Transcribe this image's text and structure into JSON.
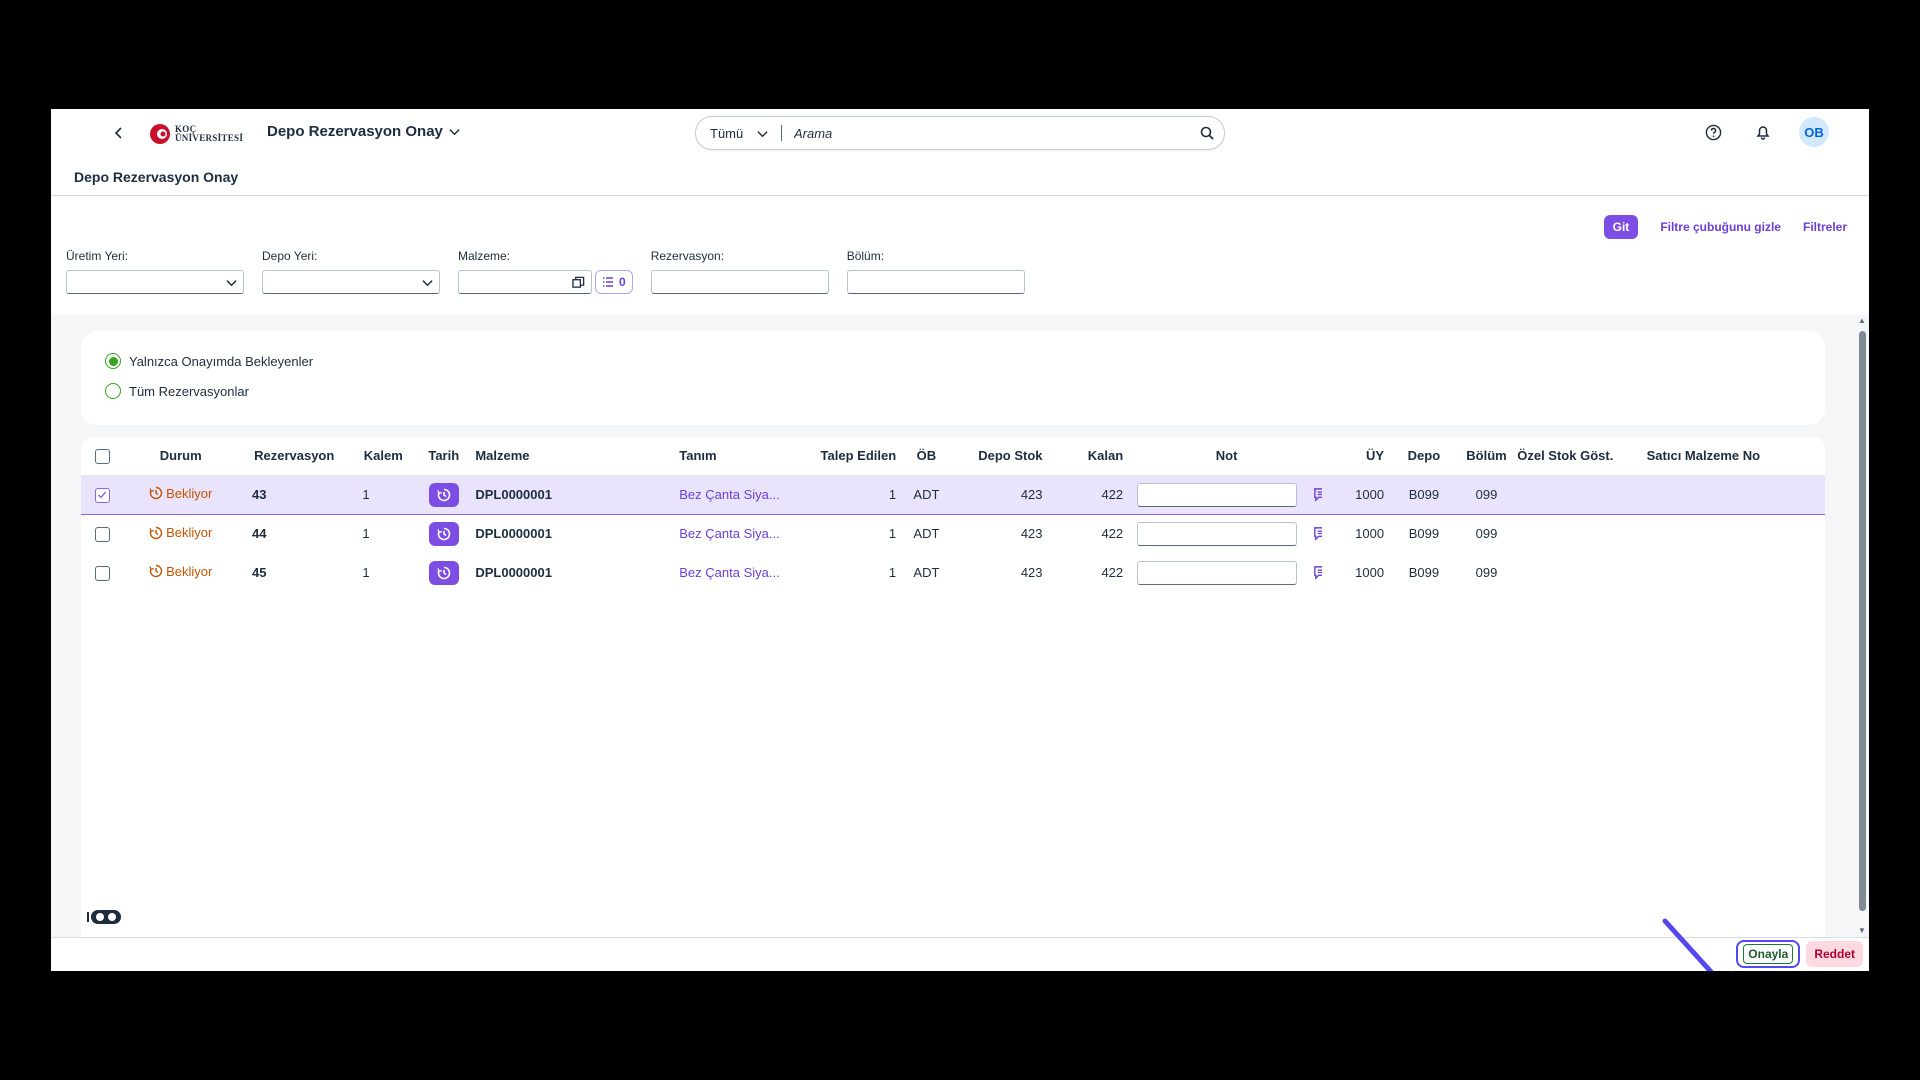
{
  "colors": {
    "accent": "#7d4ee3",
    "pending": "#c35500",
    "radio_selected": "#36a41d",
    "annotation_arrow": "#5548f0",
    "reject_bg": "#fdd9e1"
  },
  "shell": {
    "logo_line1": "KOÇ",
    "logo_line2": "ÜNİVERSİTESİ",
    "app_title": "Depo Rezervasyon Onay",
    "search_scope": "Tümü",
    "search_placeholder": "Arama",
    "avatar_initials": "OB"
  },
  "page": {
    "title": "Depo Rezervasyon Onay"
  },
  "filter_bar": {
    "go_label": "Git",
    "hide_label": "Filtre çubuğunu gizle",
    "filters_label": "Filtreler",
    "fields": {
      "plant_label": "Üretim Yeri:",
      "storage_label": "Depo Yeri:",
      "material_label": "Malzeme:",
      "material_token_count": "0",
      "reservation_label": "Rezervasyon:",
      "section_label": "Bölüm:"
    }
  },
  "radio_options": {
    "pending_only": "Yalnızca Onayımda Bekleyenler",
    "all": "Tüm Rezervasyonlar"
  },
  "table": {
    "columns": {
      "status": "Durum",
      "reservation": "Rezervasyon",
      "item": "Kalem",
      "date": "Tarih",
      "material": "Malzeme",
      "description": "Tanım",
      "requested": "Talep Edilen",
      "unit": "ÖB",
      "stock": "Depo Stok",
      "remaining": "Kalan",
      "note": "Not",
      "plant": "ÜY",
      "storage": "Depo",
      "section": "Bölüm",
      "special_stock": "Özel Stok Göst.",
      "vendor_material": "Satıcı Malzeme No"
    },
    "rows": [
      {
        "status": "Bekliyor",
        "reservation": "43",
        "item": "1",
        "material": "DPL0000001",
        "description": "Bez Çanta Siya...",
        "requested": "1",
        "unit": "ADT",
        "stock": "423",
        "remaining": "422",
        "plant": "1000",
        "storage": "B099",
        "section": "099",
        "selected": true
      },
      {
        "status": "Bekliyor",
        "reservation": "44",
        "item": "1",
        "material": "DPL0000001",
        "description": "Bez Çanta Siya...",
        "requested": "1",
        "unit": "ADT",
        "stock": "423",
        "remaining": "422",
        "plant": "1000",
        "storage": "B099",
        "section": "099",
        "selected": false
      },
      {
        "status": "Bekliyor",
        "reservation": "45",
        "item": "1",
        "material": "DPL0000001",
        "description": "Bez Çanta Siya...",
        "requested": "1",
        "unit": "ADT",
        "stock": "423",
        "remaining": "422",
        "plant": "1000",
        "storage": "B099",
        "section": "099",
        "selected": false
      }
    ]
  },
  "footer": {
    "approve_label": "Onayla",
    "reject_label": "Reddet"
  }
}
